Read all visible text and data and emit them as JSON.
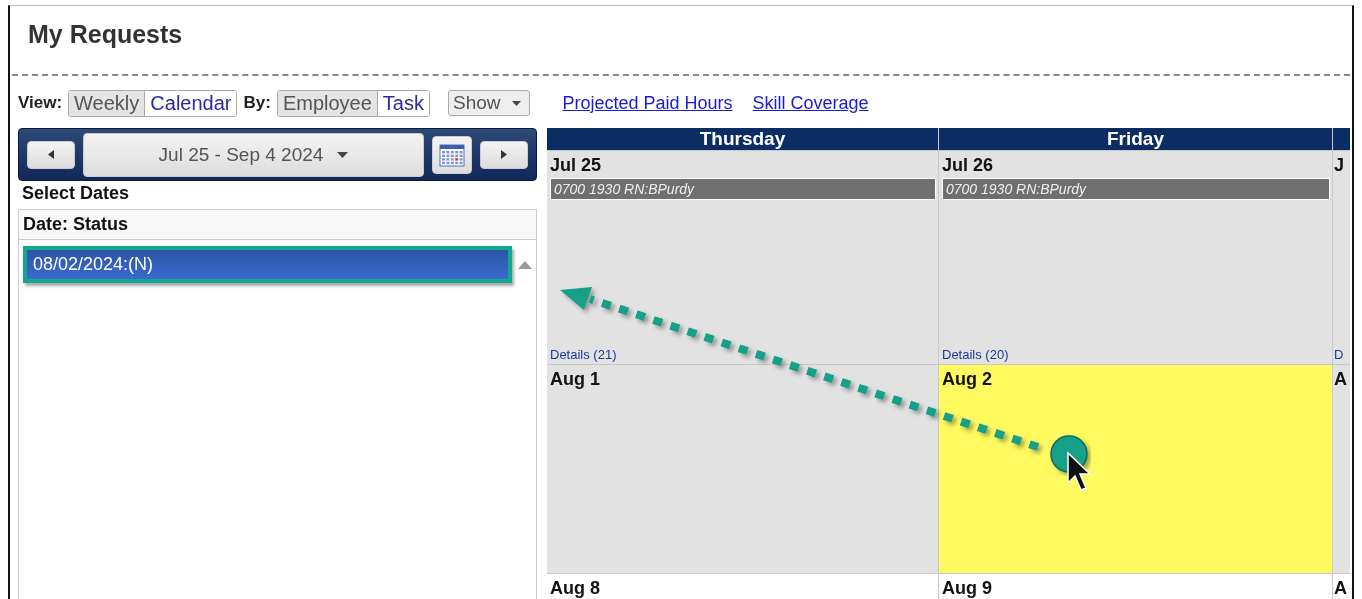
{
  "title": "My Requests",
  "view": {
    "label": "View:",
    "options": [
      {
        "label": "Weekly",
        "selected": false
      },
      {
        "label": "Calendar",
        "selected": true
      }
    ]
  },
  "by": {
    "label": "By:",
    "options": [
      {
        "label": "Employee",
        "selected": false
      },
      {
        "label": "Task",
        "selected": true
      }
    ]
  },
  "show_menu": {
    "label": "Show"
  },
  "links": [
    "Projected Paid Hours",
    "Skill Coverage"
  ],
  "date_nav": {
    "range": "Jul 25 - Sep 4 2024"
  },
  "select_dates_label": "Select Dates",
  "date_list": {
    "header": "Date: Status",
    "items": [
      {
        "text": "08/02/2024:(N)",
        "selected": true
      }
    ]
  },
  "calendar": {
    "weekdays": [
      "Thursday",
      "Friday"
    ],
    "weeks": [
      {
        "days": [
          {
            "date": "Jul 25",
            "shaded": true,
            "selected": false,
            "shifts": [
              "0700 1930 RN:BPurdy"
            ],
            "details": "Details (21)"
          },
          {
            "date": "Jul 26",
            "shaded": true,
            "selected": false,
            "shifts": [
              "0700 1930 RN:BPurdy"
            ],
            "details": "Details (20)"
          },
          {
            "date": "J",
            "shaded": true,
            "selected": false,
            "details": "D"
          }
        ]
      },
      {
        "days": [
          {
            "date": "Aug 1",
            "shaded": true,
            "selected": false
          },
          {
            "date": "Aug 2",
            "shaded": true,
            "selected": true
          },
          {
            "date": "A",
            "shaded": true,
            "selected": false
          }
        ]
      },
      {
        "days": [
          {
            "date": "Aug 8",
            "shaded": false,
            "selected": false
          },
          {
            "date": "Aug 9",
            "shaded": false,
            "selected": false
          },
          {
            "date": "A",
            "shaded": false,
            "selected": false
          }
        ]
      }
    ]
  }
}
